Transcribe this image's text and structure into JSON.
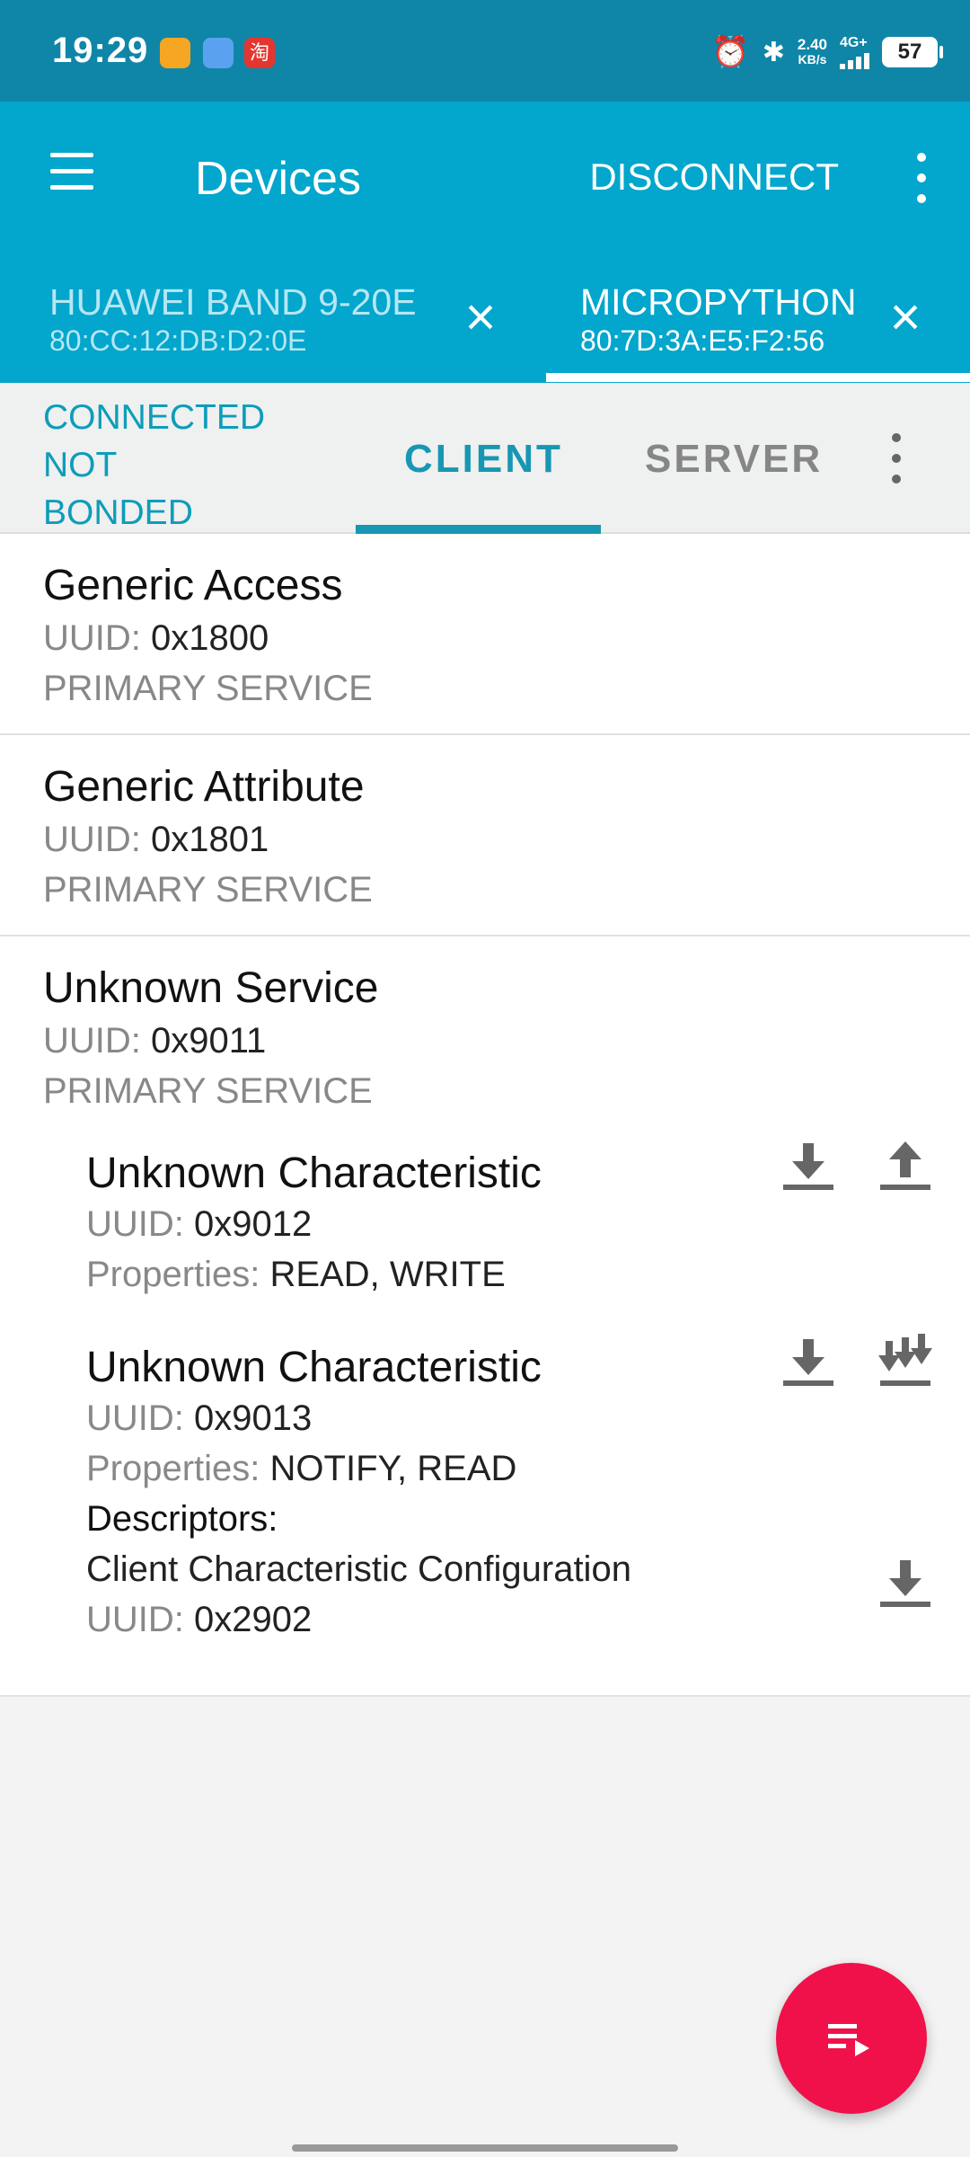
{
  "status_bar": {
    "time": "19:29",
    "app_icons": [
      "notes-app-icon",
      "weather-app-icon",
      "taobao-app-icon"
    ],
    "taobao_glyph": "淘",
    "net_speed_value": "2.40",
    "net_speed_unit": "KB/s",
    "network_type": "4G+",
    "battery": "57"
  },
  "app_bar": {
    "title": "Devices",
    "disconnect_label": "DISCONNECT"
  },
  "device_tabs": [
    {
      "name": "HUAWEI BAND 9-20E",
      "address": "80:CC:12:DB:D2:0E"
    },
    {
      "name": "MICROPYTHON",
      "address": "80:7D:3A:E5:F2:56"
    }
  ],
  "connection": {
    "line1": "CONNECTED",
    "line2": "NOT",
    "line3": "BONDED"
  },
  "subtabs": {
    "client": "CLIENT",
    "server": "SERVER"
  },
  "labels": {
    "uuid": "UUID:",
    "properties": "Properties:",
    "descriptors": "Descriptors:"
  },
  "services": [
    {
      "name": "Generic Access",
      "uuid": "0x1800",
      "type": "PRIMARY SERVICE"
    },
    {
      "name": "Generic Attribute",
      "uuid": "0x1801",
      "type": "PRIMARY SERVICE"
    },
    {
      "name": "Unknown Service",
      "uuid": "0x9011",
      "type": "PRIMARY SERVICE"
    }
  ],
  "characteristics": [
    {
      "name": "Unknown Characteristic",
      "uuid": "0x9012",
      "properties": "READ, WRITE"
    },
    {
      "name": "Unknown Characteristic",
      "uuid": "0x9013",
      "properties": "NOTIFY, READ"
    }
  ],
  "descriptor": {
    "name": "Client Characteristic Configuration",
    "uuid": "0x2902"
  },
  "colors": {
    "status_bar": "#0f86a8",
    "app_bar": "#03a6cc",
    "accent": "#1797b3",
    "fab": "#f0114a"
  }
}
